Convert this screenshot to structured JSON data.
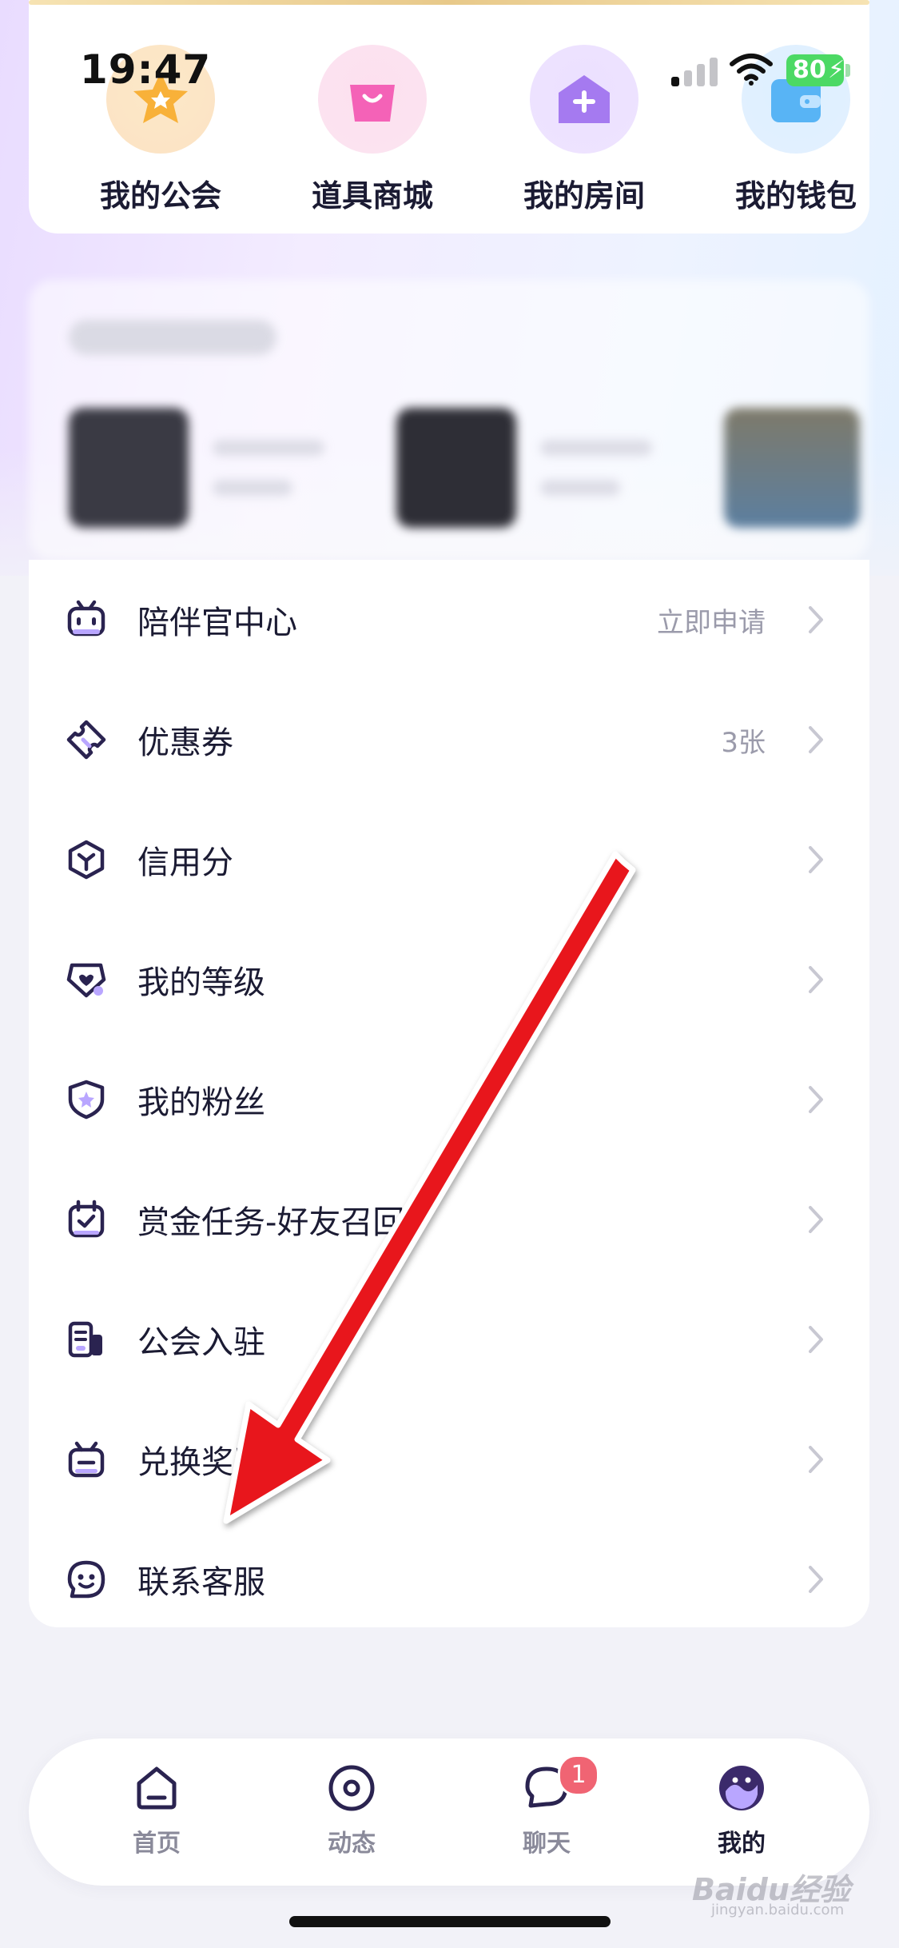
{
  "status_bar": {
    "time": "19:47",
    "battery": "80"
  },
  "quick_actions": [
    {
      "label": "我的公会",
      "icon": "star-badge-icon"
    },
    {
      "label": "道具商城",
      "icon": "shopping-bag-icon"
    },
    {
      "label": "我的房间",
      "icon": "add-home-icon"
    },
    {
      "label": "我的钱包",
      "icon": "wallet-icon"
    }
  ],
  "menu": [
    {
      "label": "陪伴官中心",
      "value": "立即申请",
      "icon": "companion-robot-icon"
    },
    {
      "label": "优惠券",
      "value": "3张",
      "icon": "ticket-icon"
    },
    {
      "label": "信用分",
      "value": "",
      "icon": "credit-cube-icon"
    },
    {
      "label": "我的等级",
      "value": "",
      "icon": "heart-level-icon"
    },
    {
      "label": "我的粉丝",
      "value": "",
      "icon": "shield-star-icon"
    },
    {
      "label": "赏金任务-好友召回",
      "value": "",
      "icon": "calendar-check-icon"
    },
    {
      "label": "公会入驻",
      "value": "",
      "icon": "building-icon"
    },
    {
      "label": "兑换奖励",
      "value": "",
      "icon": "gift-box-icon"
    },
    {
      "label": "联系客服",
      "value": "",
      "icon": "smiley-service-icon"
    }
  ],
  "tab_bar": {
    "tabs": [
      {
        "label": "首页",
        "icon": "home-icon",
        "active": false
      },
      {
        "label": "动态",
        "icon": "target-icon",
        "active": false
      },
      {
        "label": "聊天",
        "icon": "chat-bubble-icon",
        "active": false,
        "badge": "1"
      },
      {
        "label": "我的",
        "icon": "profile-face-icon",
        "active": true
      }
    ]
  },
  "watermark": {
    "text": "Baidu经验",
    "sub": "jingyan.baidu.com"
  },
  "colors": {
    "accent_purple": "#3b2a6b",
    "badge_red": "#f06473",
    "annotation_red": "#e8141c"
  }
}
